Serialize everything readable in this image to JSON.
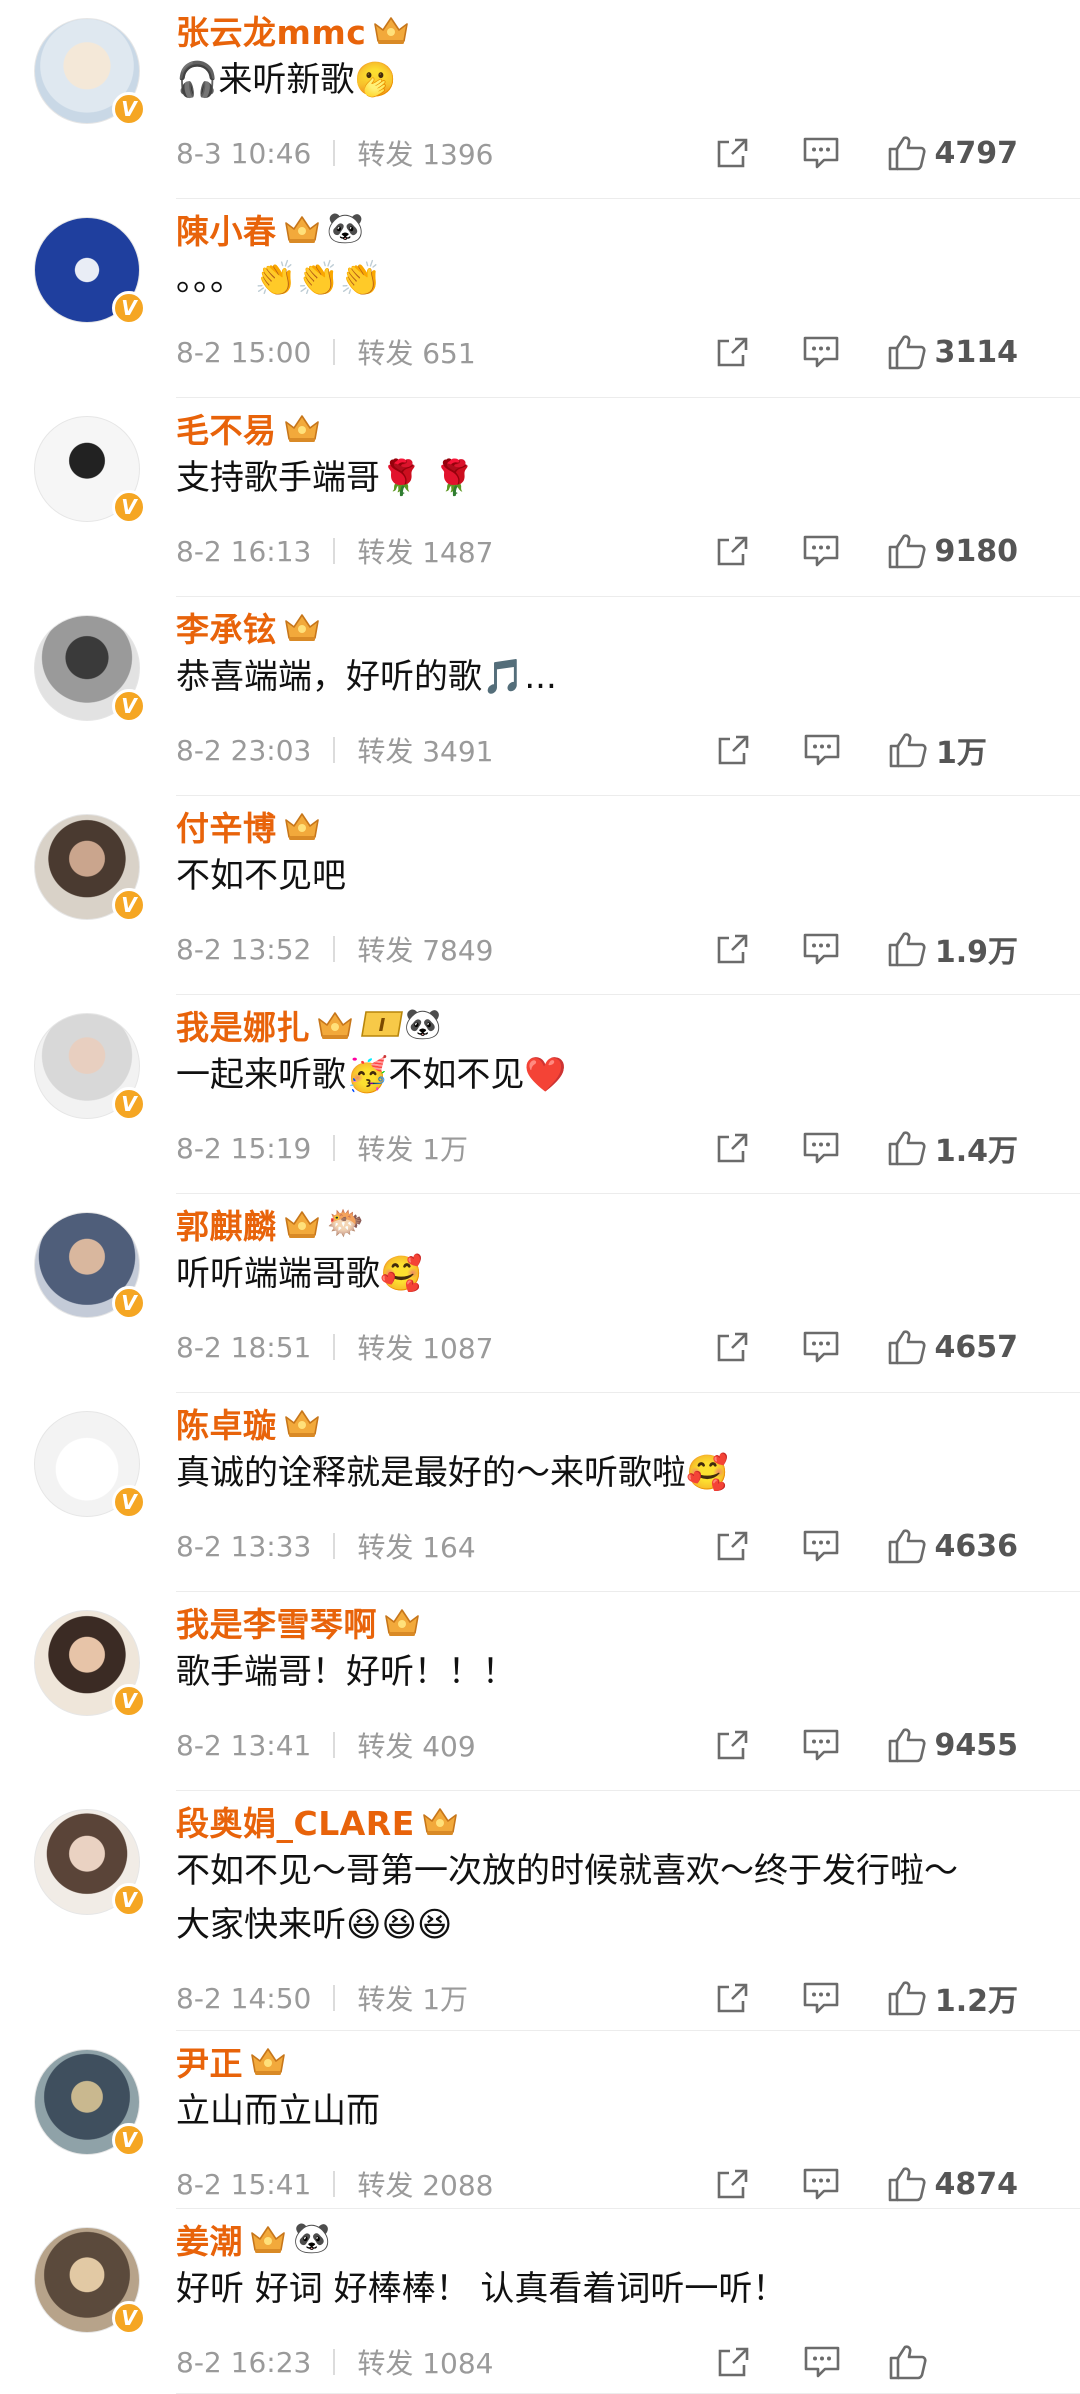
{
  "labels": {
    "repost_prefix": "转发"
  },
  "colors": {
    "name": "#e8630a",
    "meta": "#9a9a9a",
    "badge": "#f5a623"
  },
  "comments": [
    {
      "name": "张云龙mmc",
      "badges": [
        "crown-badge"
      ],
      "extra": "",
      "text": "🎧来听新歌🫢",
      "time": "8-3 10:46",
      "repost": "转发 1396",
      "likes": "4797"
    },
    {
      "name": "陳小春",
      "badges": [
        "crown-badge"
      ],
      "extra": "🐼",
      "text": "。。。 👏👏👏",
      "time": "8-2 15:00",
      "repost": "转发 651",
      "likes": "3114"
    },
    {
      "name": "毛不易",
      "badges": [
        "crown-badge"
      ],
      "extra": "",
      "text": "支持歌手端哥🌹 🌹",
      "time": "8-2 16:13",
      "repost": "转发 1487",
      "likes": "9180"
    },
    {
      "name": "李承铉",
      "badges": [
        "crown-badge"
      ],
      "extra": "",
      "text": "恭喜端端，好听的歌🎵...",
      "time": "8-2 23:03",
      "repost": "转发 3491",
      "likes": "1万"
    },
    {
      "name": "付辛博",
      "badges": [
        "crown-badge"
      ],
      "extra": "",
      "text": "不如不见吧",
      "time": "8-2 13:52",
      "repost": "转发 7849",
      "likes": "1.9万"
    },
    {
      "name": "我是娜扎",
      "badges": [
        "crown-badge",
        "level-badge"
      ],
      "extra": "🐼",
      "text": "一起来听歌🥳不如不见❤️",
      "time": "8-2 15:19",
      "repost": "转发 1万",
      "likes": "1.4万"
    },
    {
      "name": "郭麒麟",
      "badges": [
        "crown-badge"
      ],
      "extra": "🐡",
      "text": "听听端端哥歌🥰",
      "time": "8-2 18:51",
      "repost": "转发 1087",
      "likes": "4657"
    },
    {
      "name": "陈卓璇",
      "badges": [
        "crown-badge"
      ],
      "extra": "",
      "text": "真诚的诠释就是最好的～来听歌啦🥰",
      "time": "8-2 13:33",
      "repost": "转发 164",
      "likes": "4636"
    },
    {
      "name": "我是李雪琴啊",
      "badges": [
        "crown-badge"
      ],
      "extra": "",
      "text": "歌手端哥！好听！！！",
      "time": "8-2 13:41",
      "repost": "转发 409",
      "likes": "9455"
    },
    {
      "name": "段奥娟_CLARE",
      "badges": [
        "crown-badge"
      ],
      "extra": "",
      "text": "不如不见～哥第一次放的时候就喜欢～终于发行啦～\n大家快来听😆😆😆",
      "time": "8-2 14:50",
      "repost": "转发 1万",
      "likes": "1.2万"
    },
    {
      "name": "尹正",
      "badges": [
        "crown-badge"
      ],
      "extra": "",
      "text": "立山而立山而",
      "time": "8-2 15:41",
      "repost": "转发 2088",
      "likes": "4874"
    },
    {
      "name": "姜潮",
      "badges": [
        "crown-badge"
      ],
      "extra": "🐼",
      "text": "好听 好词 好棒棒！ 认真看着词听一听！",
      "time": "8-2 16:23",
      "repost": "转发 1084",
      "likes": ""
    }
  ]
}
